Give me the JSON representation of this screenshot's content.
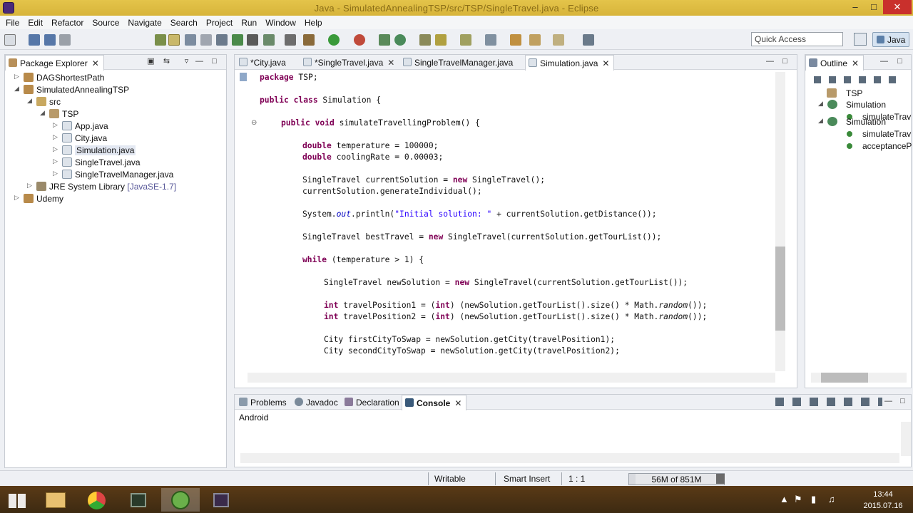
{
  "window": {
    "title": "Java - SimulatedAnnealingTSP/src/TSP/SingleTravel.java - Eclipse"
  },
  "menu": [
    "File",
    "Edit",
    "Refactor",
    "Source",
    "Navigate",
    "Search",
    "Project",
    "Run",
    "Window",
    "Help"
  ],
  "toolbar": {
    "quick_access": "Quick Access",
    "perspective": "Java"
  },
  "package_explorer": {
    "title": "Package Explorer",
    "items": [
      {
        "label": "DAGShortestPath"
      },
      {
        "label": "SimulatedAnnealingTSP"
      },
      {
        "label": "src"
      },
      {
        "label": "TSP"
      },
      {
        "label": "App.java"
      },
      {
        "label": "City.java"
      },
      {
        "label": "Simulation.java"
      },
      {
        "label": "SingleTravel.java"
      },
      {
        "label": "SingleTravelManager.java"
      },
      {
        "label": "JRE System Library",
        "sub": "[JavaSE-1.7]"
      },
      {
        "label": "Udemy"
      }
    ]
  },
  "editor": {
    "tabs": [
      {
        "label": "*City.java"
      },
      {
        "label": "*SingleTravel.java"
      },
      {
        "label": "SingleTravelManager.java"
      },
      {
        "label": "Simulation.java"
      }
    ],
    "code": [
      "package TSP;",
      "public class Simulation {",
      "public void simulateTravellingProblem() {",
      "double temperature = 100000;",
      "double coolingRate = 0.00003;",
      "SingleTravel currentSolution = new SingleTravel();",
      "currentSolution.generateIndividual();",
      "System.out.println(\"Initial solution: \" + currentSolution.getDistance());",
      "SingleTravel bestTravel = new SingleTravel(currentSolution.getTourList());",
      "while (temperature > 1) {",
      "SingleTravel newSolution = new SingleTravel(currentSolution.getTourList());",
      "int travelPosition1 = (int) (newSolution.getTourList().size() * Math.random());",
      "int travelPosition2 = (int) (newSolution.getTourList().size() * Math.random());",
      "City firstCityToSwap = newSolution.getCity(travelPosition1);",
      "City secondCityToSwap = newSolution.getCity(travelPosition2);"
    ]
  },
  "outline": {
    "title": "Outline",
    "items": [
      "TSP",
      "Simulation",
      "simulateTrav",
      "Simulation",
      "simulateTrav",
      "acceptanceP"
    ]
  },
  "bottom": {
    "tabs": [
      "Problems",
      "Javadoc",
      "Declaration",
      "Console"
    ],
    "console_label": "Android"
  },
  "status": {
    "writable": "Writable",
    "insert_mode": "Smart Insert",
    "position": "1 : 1",
    "heap": "56M of 851M",
    "heap_used_fraction": 0.066
  },
  "taskbar": {
    "time": "13:44",
    "date": "2015.07.16"
  }
}
